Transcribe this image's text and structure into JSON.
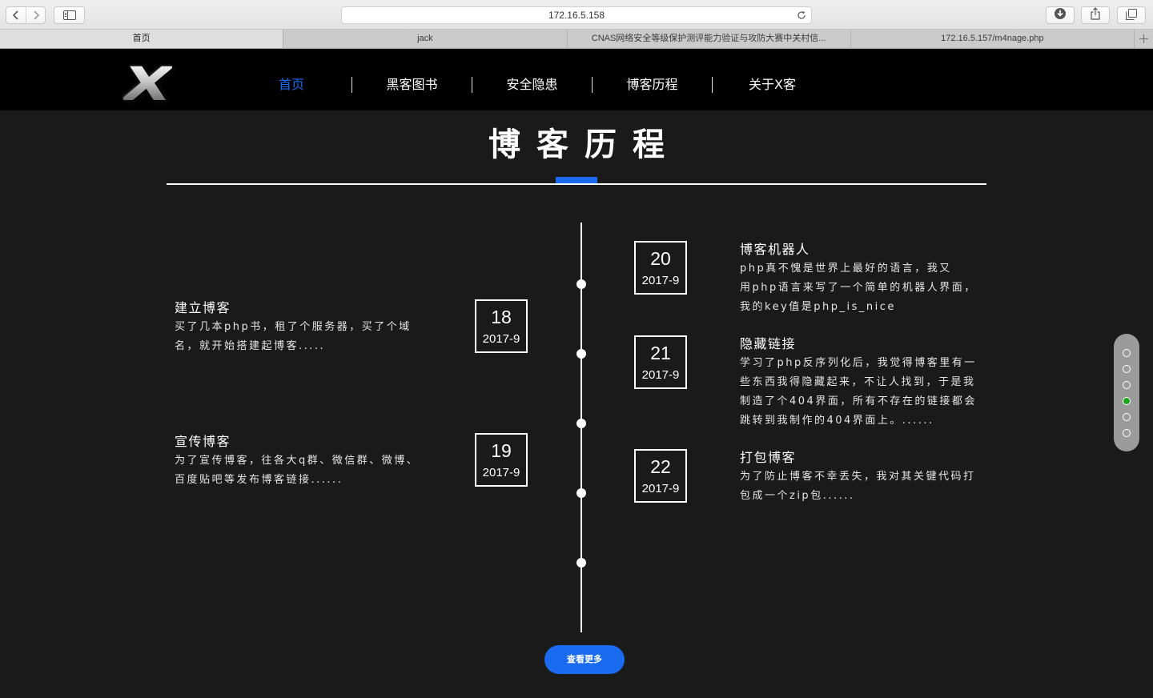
{
  "browser": {
    "url": "172.16.5.158",
    "tabs": [
      {
        "label": "首页",
        "active": true
      },
      {
        "label": "jack",
        "active": false
      },
      {
        "label": "CNAS网络安全等级保护测评能力验证与攻防大赛中关村信...",
        "active": false
      },
      {
        "label": "172.16.5.157/m4nage.php",
        "active": false
      }
    ],
    "toolbar_icons": [
      "back-icon",
      "forward-icon",
      "sidebar-icon",
      "reload-icon",
      "download-icon",
      "share-icon",
      "tabs-overview-icon",
      "new-tab-icon"
    ]
  },
  "site": {
    "logo": {
      "text": "X"
    },
    "nav": [
      {
        "label": "首页",
        "active": true
      },
      {
        "label": "黑客图书",
        "active": false
      },
      {
        "label": "安全隐患",
        "active": false
      },
      {
        "label": "博客历程",
        "active": false
      },
      {
        "label": "关于X客",
        "active": false
      }
    ]
  },
  "section": {
    "title": "博客历程"
  },
  "timeline": {
    "left": [
      {
        "day": "18",
        "month": "2017-9",
        "title": "建立博客",
        "lines": [
          "买了几本php书，租了个服务器，买了个域",
          "名，就开始搭建起博客....."
        ]
      },
      {
        "day": "19",
        "month": "2017-9",
        "title": "宣传博客",
        "lines": [
          "为了宣传博客，往各大q群、微信群、微博、",
          "百度贴吧等发布博客链接......"
        ]
      }
    ],
    "right": [
      {
        "day": "20",
        "month": "2017-9",
        "title": "博客机器人",
        "lines": [
          "php真不愧是世界上最好的语言，我又",
          "用php语言来写了一个简单的机器人界面，",
          "我的key值是php_is_nice"
        ]
      },
      {
        "day": "21",
        "month": "2017-9",
        "title": "隐藏链接",
        "lines": [
          "学习了php反序列化后，我觉得博客里有一",
          "些东西我得隐藏起来，不让人找到，于是我",
          "制造了个404界面，所有不存在的链接都会",
          "跳转到我制作的404界面上。......"
        ]
      },
      {
        "day": "22",
        "month": "2017-9",
        "title": "打包博客",
        "lines": [
          "为了防止博客不幸丢失，我对其关键代码打",
          "包成一个zip包......"
        ]
      }
    ]
  },
  "more_button": {
    "label": "查看更多"
  },
  "page_dots": {
    "count": 6,
    "active_index": 3
  },
  "colors": {
    "accent": "#1a6bf0",
    "active_dot": "#18a818",
    "header_background": "#000000",
    "page_background": "#1a1a1a"
  }
}
